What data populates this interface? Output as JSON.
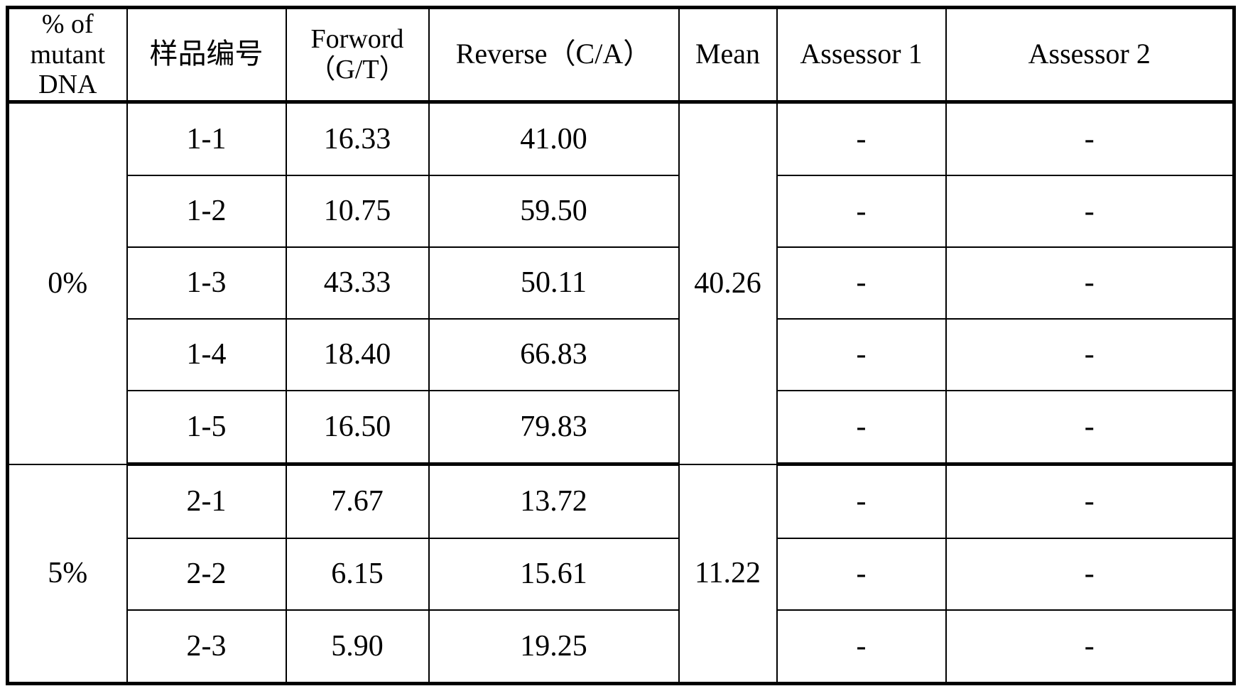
{
  "table": {
    "columns": [
      {
        "key": "pct",
        "label": "% of\nmutant\nDNA"
      },
      {
        "key": "sample",
        "label": "样品编号"
      },
      {
        "key": "forword",
        "label": "Forword\n（G/T）"
      },
      {
        "key": "reverse",
        "label": "Reverse（C/A）"
      },
      {
        "key": "mean",
        "label": "Mean"
      },
      {
        "key": "a1",
        "label": "Assessor 1"
      },
      {
        "key": "a2",
        "label": "Assessor 2"
      }
    ],
    "groups": [
      {
        "pct": "0%",
        "mean": "40.26",
        "rows": [
          {
            "sample": "1-1",
            "forword": "16.33",
            "reverse": "41.00",
            "a1": "-",
            "a2": "-"
          },
          {
            "sample": "1-2",
            "forword": "10.75",
            "reverse": "59.50",
            "a1": "-",
            "a2": "-"
          },
          {
            "sample": "1-3",
            "forword": "43.33",
            "reverse": "50.11",
            "a1": "-",
            "a2": "-"
          },
          {
            "sample": "1-4",
            "forword": "18.40",
            "reverse": "66.83",
            "a1": "-",
            "a2": "-"
          },
          {
            "sample": "1-5",
            "forword": "16.50",
            "reverse": "79.83",
            "a1": "-",
            "a2": "-"
          }
        ]
      },
      {
        "pct": "5%",
        "mean": "11.22",
        "rows": [
          {
            "sample": "2-1",
            "forword": "7.67",
            "reverse": "13.72",
            "a1": "-",
            "a2": "-"
          },
          {
            "sample": "2-2",
            "forword": "6.15",
            "reverse": "15.61",
            "a1": "-",
            "a2": "-"
          },
          {
            "sample": "2-3",
            "forword": "5.90",
            "reverse": "19.25",
            "a1": "-",
            "a2": "-"
          }
        ]
      }
    ],
    "colors": {
      "border": "#000000",
      "text": "#000000",
      "background": "#ffffff"
    }
  }
}
